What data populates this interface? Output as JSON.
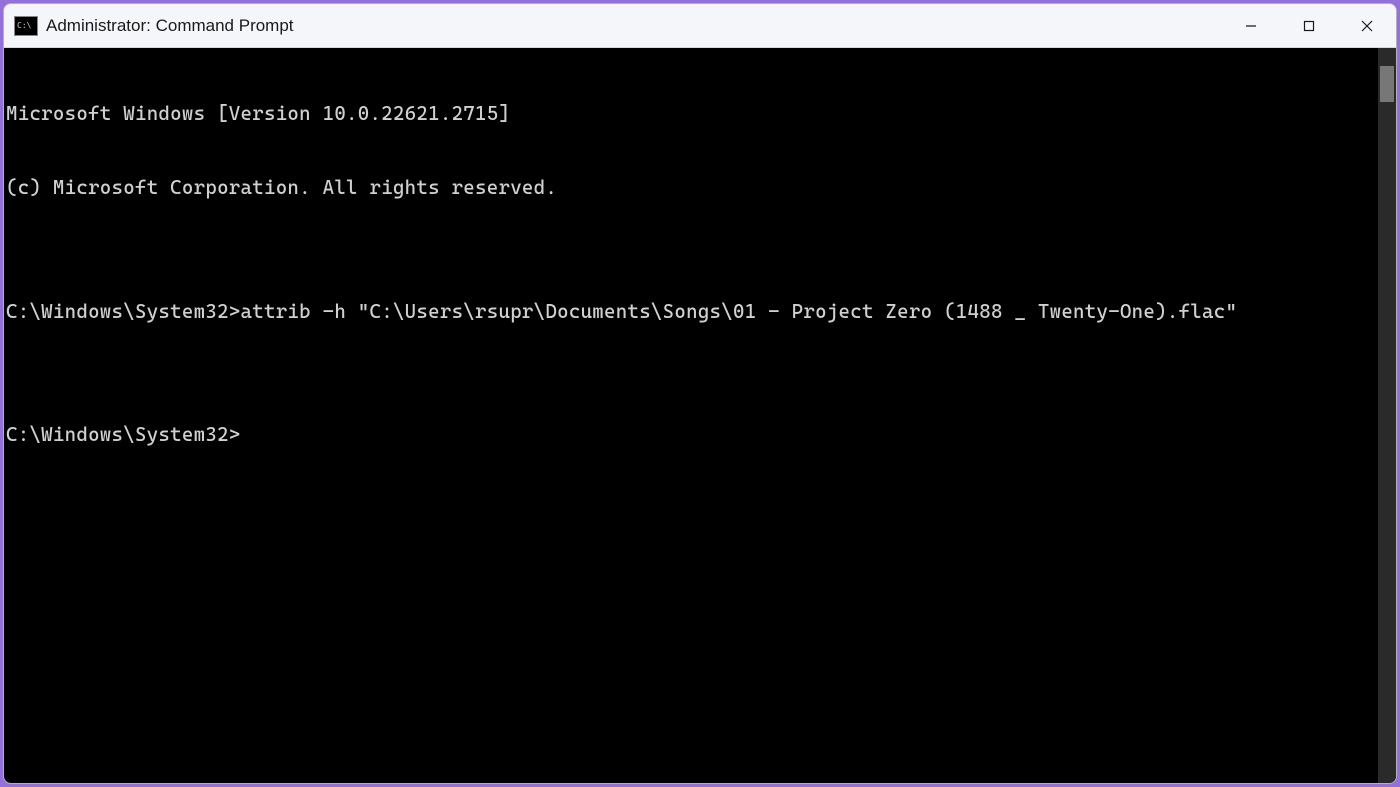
{
  "window": {
    "title": "Administrator: Command Prompt"
  },
  "terminal": {
    "lines": [
      "Microsoft Windows [Version 10.0.22621.2715]",
      "(c) Microsoft Corporation. All rights reserved.",
      "",
      "C:\\Windows\\System32>attrib -h \"C:\\Users\\rsupr\\Documents\\Songs\\01 - Project Zero (1488 _ Twenty-One).flac\"",
      "",
      "C:\\Windows\\System32>"
    ]
  }
}
